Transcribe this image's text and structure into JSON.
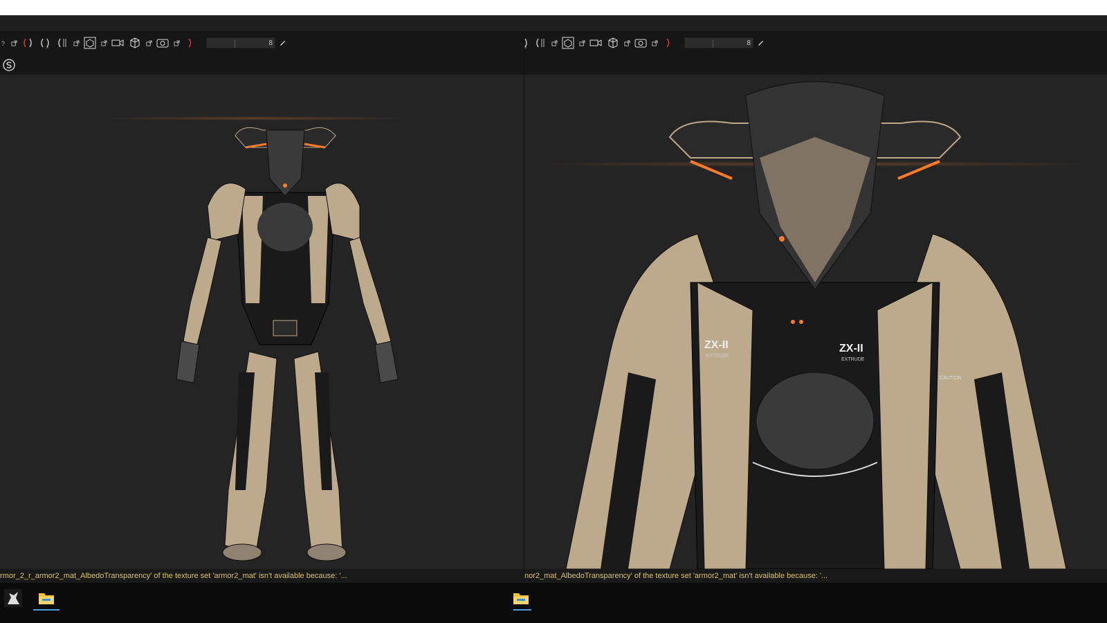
{
  "left_pane": {
    "toolbar": {
      "slider_value": "8"
    },
    "status_message": "rmor_2_r_armor2_mat_AlbedoTransparency' of the texture set 'armor2_mat' isn't available because: '..."
  },
  "right_pane": {
    "toolbar": {
      "slider_value": "8"
    },
    "status_message": "nor2_mat_AlbedoTransparency' of the texture set 'armor2_mat' isn't available because: '..."
  },
  "model": {
    "chest_label": "ZX-II",
    "chest_sublabel": "EXTRUDE",
    "caution_label": "CAUTION"
  },
  "colors": {
    "glow": "#ff7a2a",
    "armor_tan": "#bda98c",
    "armor_dark": "#1a1a1a",
    "status_text": "#d8c458",
    "viewport_bg": "#242424"
  },
  "taskbar": {
    "icons": [
      "app-icon",
      "file-explorer-icon",
      "file-explorer-icon"
    ]
  }
}
